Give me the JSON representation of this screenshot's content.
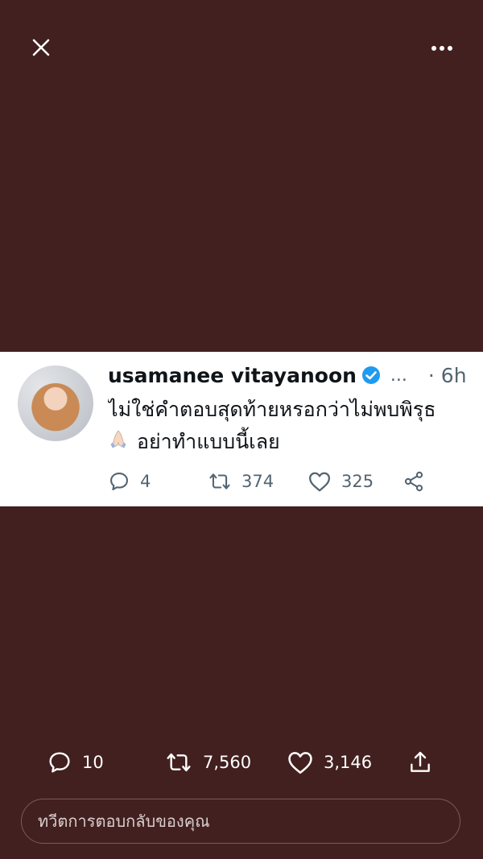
{
  "top_bar": {
    "close_icon": "close-icon",
    "more_icon": "more-horizontal-icon"
  },
  "embedded_tweet": {
    "display_name": "usamanee vitayanoon",
    "verified_icon": "verified-badge-icon",
    "ellipsis": "...",
    "timestamp": "· 6h",
    "text_line1": "ไม่ใช่คำตอบสุดท้ายหรอกว่าไม่พบพิรุธ",
    "emoji": "folded-hands-emoji",
    "text_line2": "อย่าทำแบบนี้เลย",
    "replies": "4",
    "retweets": "374",
    "likes": "325"
  },
  "post_actions": {
    "replies": "10",
    "retweets": "7,560",
    "likes": "3,146"
  },
  "reply_input": {
    "placeholder": "ทวีตการตอบกลับของคุณ"
  },
  "colors": {
    "background": "#42201f",
    "card": "#ffffff",
    "verified": "#1d9bf0",
    "muted": "#536471"
  }
}
